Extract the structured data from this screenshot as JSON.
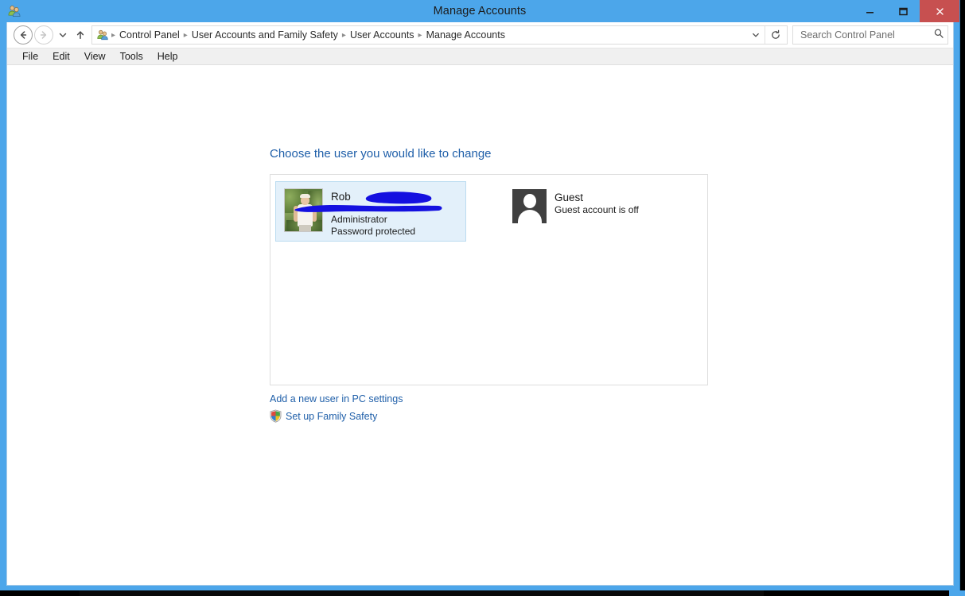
{
  "window": {
    "title": "Manage Accounts",
    "icon": "user-accounts-icon",
    "minimize_label": "Minimize",
    "maximize_label": "Maximize",
    "close_label": "Close",
    "frame_color": "#4ca6ea",
    "close_color": "#c75050"
  },
  "navbar": {
    "back_label": "Back",
    "forward_label": "Forward",
    "recent_label": "Recent pages",
    "up_label": "Up one level",
    "breadcrumb": [
      "Control Panel",
      "User Accounts and Family Safety",
      "User Accounts",
      "Manage Accounts"
    ],
    "breadcrumb_separator": "▸",
    "dropdown_label": "Previous locations",
    "refresh_label": "Refresh",
    "search": {
      "placeholder": "Search Control Panel",
      "value": "",
      "icon": "search-icon"
    }
  },
  "menubar": {
    "items": [
      "File",
      "Edit",
      "View",
      "Tools",
      "Help"
    ]
  },
  "content": {
    "heading": "Choose the user you would like to change",
    "heading_color": "#1f5fa9",
    "accounts": [
      {
        "name": "Rob",
        "avatar": "user-photo-avatar",
        "lines": [
          "Administrator",
          "Password protected"
        ],
        "selected": true,
        "redacted": true
      },
      {
        "name": "Guest",
        "avatar": "guest-silhouette-avatar",
        "lines": [
          "Guest account is off"
        ],
        "selected": false,
        "redacted": false
      }
    ],
    "links": [
      {
        "label": "Add a new user in PC settings",
        "icon": null
      },
      {
        "label": "Set up Family Safety",
        "icon": "security-shield-icon"
      }
    ],
    "link_color": "#1f5fa9"
  },
  "taskbar": {
    "text": ""
  }
}
